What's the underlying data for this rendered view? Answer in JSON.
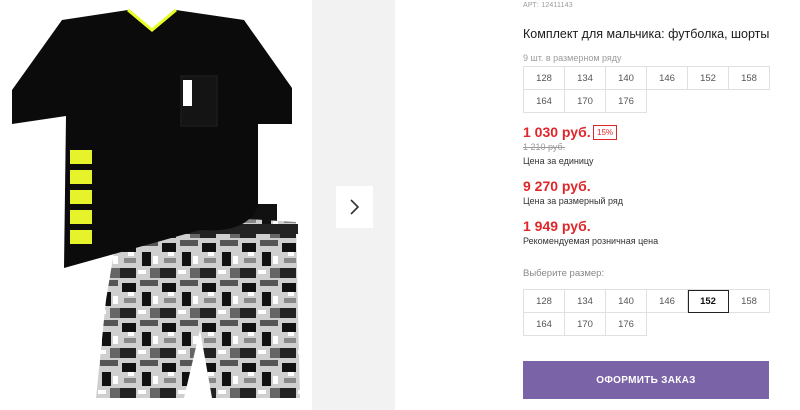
{
  "product": {
    "article": "АРТ: 12411143",
    "title": "Комплект для мальчика: футболка, шорты",
    "series_count": "9 шт. в размерном ряду"
  },
  "series_sizes": [
    "128",
    "134",
    "140",
    "146",
    "152",
    "158",
    "164",
    "170",
    "176"
  ],
  "prices": {
    "unit_price": "1 030 руб.",
    "discount": "15%",
    "old_price": "1 210 руб.",
    "unit_label": "Цена за единицу",
    "series_price": "9 270 руб.",
    "series_label": "Цена за размерный ряд",
    "rrp_price": "1 949 руб.",
    "rrp_label": "Рекомендуемая розничная цена"
  },
  "size_select": {
    "label": "Выберите размер:",
    "options": [
      "128",
      "134",
      "140",
      "146",
      "152",
      "158",
      "164",
      "170",
      "176"
    ],
    "selected": "152"
  },
  "actions": {
    "order_label": "ОФОРМИТЬ ЗАКАЗ"
  },
  "colors": {
    "price_red": "#e0262a",
    "button_purple": "#7b63a8",
    "text_muted": "#9a9a9a"
  },
  "icons": {
    "next": "chevron-right-icon"
  }
}
